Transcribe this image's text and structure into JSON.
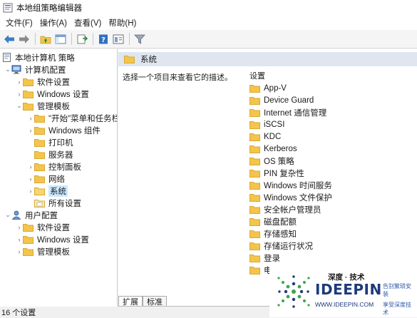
{
  "window": {
    "title": "本地组策略编辑器"
  },
  "menu": [
    "文件(F)",
    "操作(A)",
    "查看(V)",
    "帮助(H)"
  ],
  "tree": {
    "root": "本地计算机 策略",
    "computer_config": "计算机配置",
    "software_settings": "软件设置",
    "windows_settings": "Windows 设置",
    "admin_templates": "管理模板",
    "start_menu": "\"开始\"菜单和任务栏",
    "windows_components": "Windows 组件",
    "printers": "打印机",
    "servers": "服务器",
    "control_panel": "控制面板",
    "network": "网络",
    "system": "系统",
    "all_settings": "所有设置",
    "user_config": "用户配置",
    "user_software_settings": "软件设置",
    "user_windows_settings": "Windows 设置",
    "user_admin_templates": "管理模板"
  },
  "main": {
    "header_title": "系统",
    "description": "选择一个项目来查看它的描述。",
    "column_header": "设置",
    "items": [
      "App-V",
      "Device Guard",
      "Internet 通信管理",
      "iSCSI",
      "KDC",
      "Kerberos",
      "OS 策略",
      "PIN 复杂性",
      "Windows 时间服务",
      "Windows 文件保护",
      "安全帐户管理员",
      "磁盘配额",
      "存储感知",
      "存储运行状况",
      "登录",
      "电源管理"
    ]
  },
  "tabs": {
    "extended": "扩展",
    "standard": "标准"
  },
  "status": {
    "text": "16 个设置"
  },
  "watermark": {
    "cn_title": "深度 · 技术",
    "brand": "IDEEPIN",
    "url": "WWW.IDEEPIN.COM",
    "side_top": "告别繁琐安装",
    "side_bottom": "享受深度技术"
  },
  "colors": {
    "folder": "#f3c54b",
    "folder_dark": "#d9a933",
    "selection": "#cce8ff",
    "header_band": "#dfe6ef",
    "brand_blue": "#1d3a7a",
    "logo_green": "#3aa64a"
  }
}
